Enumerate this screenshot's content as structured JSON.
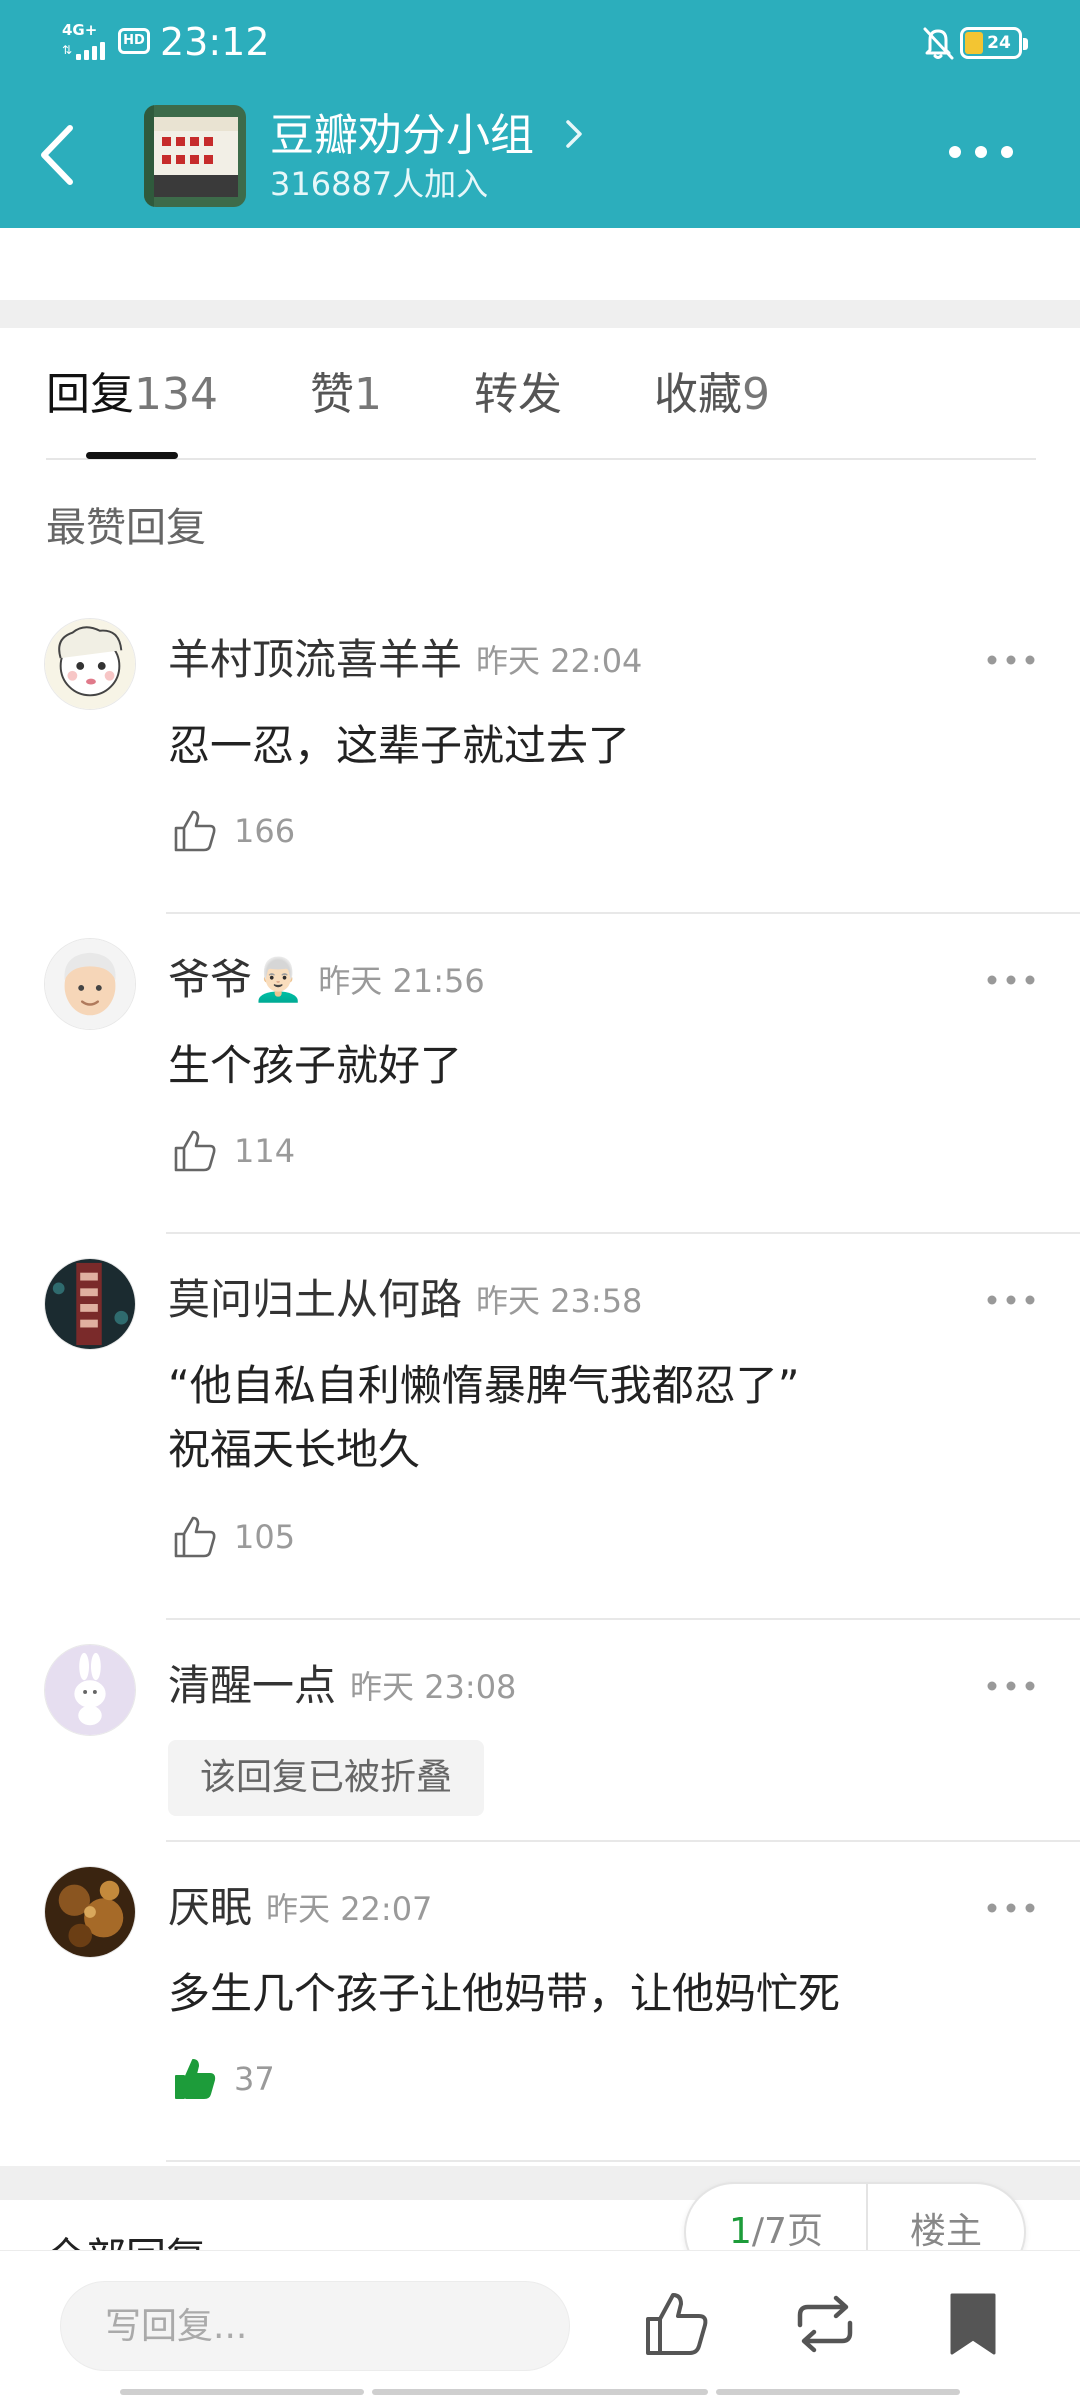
{
  "status_bar": {
    "network": "4G+",
    "hd": "HD",
    "time": "23:12",
    "battery": "24"
  },
  "header": {
    "group_name": "豆瓣劝分小组",
    "member_count": "316887人加入"
  },
  "tabs": [
    {
      "label": "回复",
      "count": "134"
    },
    {
      "label": "赞",
      "count": "1"
    },
    {
      "label": "转发",
      "count": ""
    },
    {
      "label": "收藏",
      "count": "9"
    }
  ],
  "section_title": "最赞回复",
  "comments": [
    {
      "name": "羊村顶流喜羊羊",
      "time": "昨天 22:04",
      "text": "忍一忍，这辈子就过去了",
      "likes": "166",
      "liked": false
    },
    {
      "name": "爷爷👨🏻‍🦳",
      "time": "昨天 21:56",
      "text": "生个孩子就好了",
      "likes": "114",
      "liked": false
    },
    {
      "name": "莫问归土从何路",
      "time": "昨天 23:58",
      "text_line1": "“他自私自利懒惰暴脾气我都忍了”",
      "text_line2": "祝福天长地久",
      "likes": "105",
      "liked": false
    },
    {
      "name": "清醒一点",
      "time": "昨天 23:08",
      "folded_text": "该回复已被折叠"
    },
    {
      "name": "厌眠",
      "time": "昨天 22:07",
      "text": "多生几个孩子让他妈带，让他妈忙死",
      "likes": "37",
      "liked": true
    }
  ],
  "bottom": {
    "all_replies_label": "全部回复",
    "page_current": "1",
    "page_total": "/7页",
    "op_filter": "楼主",
    "reply_placeholder": "写回复..."
  },
  "colors": {
    "header_bg": "#2caebc",
    "liked_green": "#1d9c3a",
    "battery_yellow": "#f3c532"
  },
  "icons": [
    "back-arrow-icon",
    "chevron-right-icon",
    "more-dots-icon",
    "thumbs-up-icon",
    "repost-icon",
    "bookmark-icon",
    "bell-off-icon"
  ]
}
